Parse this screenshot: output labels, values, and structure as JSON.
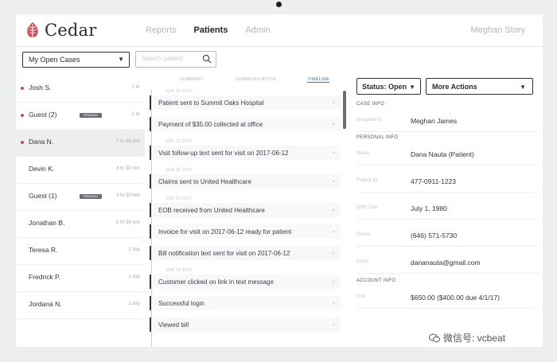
{
  "app": {
    "name": "Cedar",
    "brand_color": "#c9505a"
  },
  "nav": {
    "items": [
      "Reports",
      "Patients",
      "Admin"
    ],
    "active": 1
  },
  "user": {
    "name": "Meghan Story"
  },
  "toolbar": {
    "case_filter": "My Open Cases",
    "search_placeholder": "Search patient",
    "search_icon": "search-icon"
  },
  "patients": [
    {
      "name": "Josh S.",
      "time": "1 hr",
      "dot": true,
      "tag": ""
    },
    {
      "name": "Guest (2)",
      "time": "1 hr",
      "dot": true,
      "tag": "PENDING"
    },
    {
      "name": "Dana N.",
      "time": "2 hr 39 min",
      "dot": true,
      "tag": "",
      "selected": true
    },
    {
      "name": "Devin K.",
      "time": "4 hr 30 min",
      "dot": false,
      "tag": ""
    },
    {
      "name": "Guest (1)",
      "time": "4 hr 30 min",
      "dot": false,
      "tag": "PENDING"
    },
    {
      "name": "Jonathan B.",
      "time": "6 hr 39 min",
      "dot": false,
      "tag": ""
    },
    {
      "name": "Teresa R.",
      "time": "1 day",
      "dot": false,
      "tag": ""
    },
    {
      "name": "Fredrick P.",
      "time": "1 day",
      "dot": false,
      "tag": ""
    },
    {
      "name": "Jordana N.",
      "time": "1 day",
      "dot": false,
      "tag": ""
    }
  ],
  "timeline": {
    "tabs": [
      "SUMMARY",
      "COMMUNICATION",
      "TIMELINE"
    ],
    "active_tab": 2,
    "groups": [
      {
        "date": "JUN 12 2017",
        "events": [
          "Patient sent to Summit Oaks Hospital",
          "Payment of $35.00 collected at office"
        ]
      },
      {
        "date": "JUN 12 2017",
        "events": [
          "Visit follow-up text sent for visit on 2017-06-12"
        ]
      },
      {
        "date": "JUN 16 2017",
        "events": [
          "Claims sent to United Healthcare"
        ]
      },
      {
        "date": "JUN 23 2017",
        "events": [
          "EOB received from United Healthcare",
          "Invoice for visit on 2017-06-12 ready for patient",
          "Bill notification text sent for visit on 2017-06-12"
        ]
      },
      {
        "date": "JUN 24 2017",
        "events": [
          "Customer clicked on link in text message",
          "Successful login",
          "Viewed bill"
        ]
      }
    ]
  },
  "details": {
    "status": "Status: Open",
    "more_actions": "More Actions",
    "case_section": "CASE INFO",
    "case_fields": [
      {
        "label": "Assigned to",
        "value": "Meghan James"
      }
    ],
    "personal_section": "PERSONAL INFO",
    "personal_fields": [
      {
        "label": "Name",
        "value": "Dana Nauta (Patient)"
      },
      {
        "label": "Patient ID",
        "value": "477-0911-1223"
      },
      {
        "label": "Birth Date",
        "value": "July 1, 1980"
      },
      {
        "label": "Phone",
        "value": "(646) 571-5730"
      },
      {
        "label": "Email",
        "value": "dananauta@gmail.com"
      }
    ],
    "account_section": "ACCOUNT INFO",
    "account_fields": [
      {
        "label": "Due",
        "value": "$650.00 ($400.00 due 4/1/17)"
      }
    ]
  },
  "watermark": {
    "text": "微信号: vcbeat"
  }
}
